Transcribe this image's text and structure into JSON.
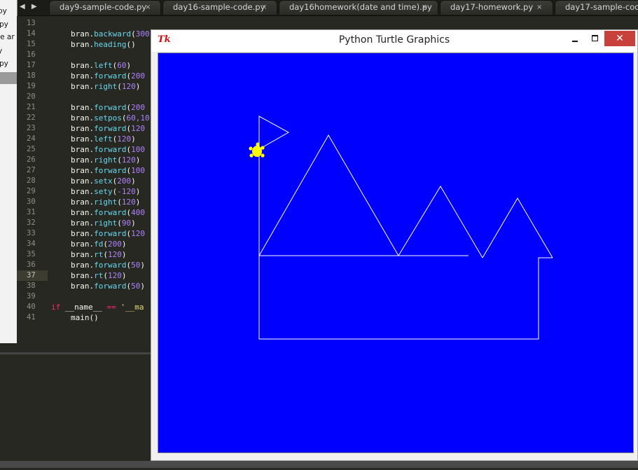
{
  "tabs": [
    {
      "label": "day9-sample-code.py",
      "close": "×"
    },
    {
      "label": "day16-sample-code.py",
      "close": "×"
    },
    {
      "label": "day16homework(date and time).py",
      "close": "×"
    },
    {
      "label": "day17-homework.py",
      "close": "×"
    },
    {
      "label": "day17-sample-code.py",
      "close": ""
    }
  ],
  "tab_nav": "◀ ▶",
  "sidebar": {
    "items": [
      "py",
      "py",
      "te ar",
      "y",
      "py"
    ]
  },
  "editor": {
    "active_line": "37",
    "line_numbers": [
      "13",
      "14",
      "15",
      "16",
      "17",
      "18",
      "19",
      "20",
      "21",
      "22",
      "23",
      "24",
      "25",
      "26",
      "27",
      "28",
      "29",
      "30",
      "31",
      "32",
      "33",
      "34",
      "35",
      "36",
      "37",
      "38",
      "39",
      "40",
      "41"
    ],
    "lines": [
      {
        "indent": "",
        "obj": "",
        "call": "",
        "arg": "",
        "tail": ""
      },
      {
        "indent": "    ",
        "obj": "bran.",
        "call": "backward",
        "arg": "300",
        "tail": "("
      },
      {
        "indent": "    ",
        "obj": "bran.",
        "call": "heading",
        "arg": "",
        "tail": "()"
      },
      {
        "indent": "",
        "obj": "",
        "call": "",
        "arg": "",
        "tail": ""
      },
      {
        "indent": "    ",
        "obj": "bran.",
        "call": "left",
        "arg": "60",
        "tail": ")"
      },
      {
        "indent": "    ",
        "obj": "bran.",
        "call": "forward",
        "arg": "200",
        "tail": ""
      },
      {
        "indent": "    ",
        "obj": "bran.",
        "call": "right",
        "arg": "120",
        "tail": ")"
      },
      {
        "indent": "",
        "obj": "",
        "call": "",
        "arg": "",
        "tail": ""
      },
      {
        "indent": "    ",
        "obj": "bran.",
        "call": "forward",
        "arg": "200",
        "tail": ""
      },
      {
        "indent": "    ",
        "obj": "bran.",
        "call": "setpos",
        "arg": "60,10",
        "tail": ""
      },
      {
        "indent": "    ",
        "obj": "bran.",
        "call": "forward",
        "arg": "120",
        "tail": ""
      },
      {
        "indent": "    ",
        "obj": "bran.",
        "call": "left",
        "arg": "120",
        "tail": ")"
      },
      {
        "indent": "    ",
        "obj": "bran.",
        "call": "forward",
        "arg": "100",
        "tail": ""
      },
      {
        "indent": "    ",
        "obj": "bran.",
        "call": "right",
        "arg": "120",
        "tail": ")"
      },
      {
        "indent": "    ",
        "obj": "bran.",
        "call": "forward",
        "arg": "100",
        "tail": ""
      },
      {
        "indent": "    ",
        "obj": "bran.",
        "call": "setx",
        "arg": "200",
        "tail": ")"
      },
      {
        "indent": "    ",
        "obj": "bran.",
        "call": "sety",
        "arg": "-120",
        "tail": ")"
      },
      {
        "indent": "    ",
        "obj": "bran.",
        "call": "right",
        "arg": "120",
        "tail": ")"
      },
      {
        "indent": "    ",
        "obj": "bran.",
        "call": "forward",
        "arg": "400",
        "tail": ""
      },
      {
        "indent": "    ",
        "obj": "bran.",
        "call": "right",
        "arg": "90",
        "tail": ")"
      },
      {
        "indent": "    ",
        "obj": "bran.",
        "call": "forward",
        "arg": "120",
        "tail": ""
      },
      {
        "indent": "    ",
        "obj": "bran.",
        "call": "fd",
        "arg": "200",
        "tail": ")"
      },
      {
        "indent": "    ",
        "obj": "bran.",
        "call": "rt",
        "arg": "120",
        "tail": ")"
      },
      {
        "indent": "    ",
        "obj": "bran.",
        "call": "forward",
        "arg": "50",
        "tail": ")"
      },
      {
        "indent": "    ",
        "obj": "bran.",
        "call": "rt",
        "arg": "120",
        "tail": ")"
      },
      {
        "indent": "    ",
        "obj": "bran.",
        "call": "forward",
        "arg": "50",
        "tail": ")"
      },
      {
        "indent": "",
        "obj": "",
        "call": "",
        "arg": "",
        "tail": ""
      },
      {
        "indent": "",
        "kw": "if",
        "text": " __name__ ",
        "op": "==",
        "str": " '__ma",
        "special": "main"
      },
      {
        "indent": "    ",
        "obj": "",
        "call": "",
        "arg": "",
        "tail": "main()",
        "plain": true
      }
    ]
  },
  "turtle_window": {
    "icon": "Tk",
    "title": "Python Turtle Graphics",
    "close": "✕",
    "canvas_bg": "#0000ff",
    "line_color": "#ffffff",
    "turtle_color": "#ffff00"
  },
  "colors": {
    "editor_bg": "#272822",
    "number": "#ae81ff",
    "function": "#66d9ef",
    "keyword": "#f92672",
    "string": "#e6db74"
  }
}
